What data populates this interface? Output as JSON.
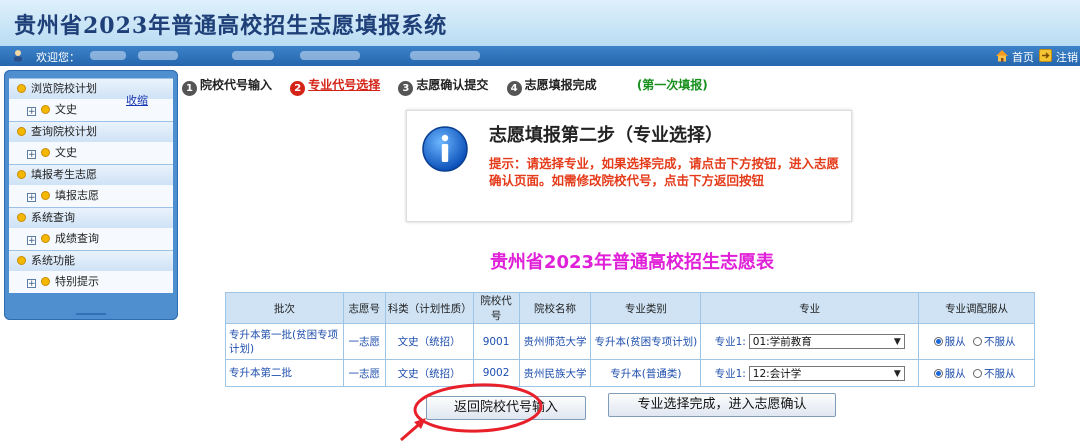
{
  "header": {
    "title": "贵州省2023年普通高校招生志愿填报系统"
  },
  "userbar": {
    "welcome": "欢迎您：",
    "home": "首页",
    "logout": "注销"
  },
  "sidebar": {
    "collapse": "收缩",
    "groups": [
      {
        "label": "浏览院校计划",
        "sub": "文史"
      },
      {
        "label": "查询院校计划",
        "sub": "文史"
      },
      {
        "label": "填报考生志愿",
        "sub": "填报志愿"
      },
      {
        "label": "系统查询",
        "sub": "成绩查询"
      },
      {
        "label": "系统功能",
        "sub": "特别提示"
      }
    ]
  },
  "steps": [
    {
      "num": "1",
      "label": "院校代号输入"
    },
    {
      "num": "2",
      "label": "专业代号选择"
    },
    {
      "num": "3",
      "label": "志愿确认提交"
    },
    {
      "num": "4",
      "label": "志愿填报完成"
    }
  ],
  "round_note": "(第一次填报)",
  "notice": {
    "title": "志愿填报第二步（专业选择）",
    "text": "提示：请选择专业，如果选择完成，请点击下方按钮，进入志愿确认页面。如需修改院校代号，点击下方返回按钮"
  },
  "table_title": "贵州省2023年普通高校招生志愿表",
  "table": {
    "headers": [
      "批次",
      "志愿号",
      "科类（计划性质）",
      "院校代号",
      "院校名称",
      "专业类别",
      "专业",
      "专业调配服从"
    ],
    "rows": [
      {
        "batch": "专升本第一批(贫困专项计划)",
        "order": "一志愿",
        "category": "文史（统招）",
        "code": "9001",
        "school": "贵州师范大学",
        "type": "专升本(贫困专项计划)",
        "major_label": "专业1:",
        "major": "01:学前教育",
        "obey": "服从",
        "not_obey": "不服从"
      },
      {
        "batch": "专升本第二批",
        "order": "一志愿",
        "category": "文史（统招）",
        "code": "9002",
        "school": "贵州民族大学",
        "type": "专升本(普通类)",
        "major_label": "专业1:",
        "major": "12:会计学",
        "obey": "服从",
        "not_obey": "不服从"
      }
    ]
  },
  "buttons": {
    "back": "返回院校代号输入",
    "next": "专业选择完成，进入志愿确认"
  },
  "colors": {
    "header_text": "#1e3f78",
    "active_step": "#d42418",
    "hint_text": "#e43b1a",
    "table_title": "#e020d8",
    "annotation": "#e8202a"
  }
}
